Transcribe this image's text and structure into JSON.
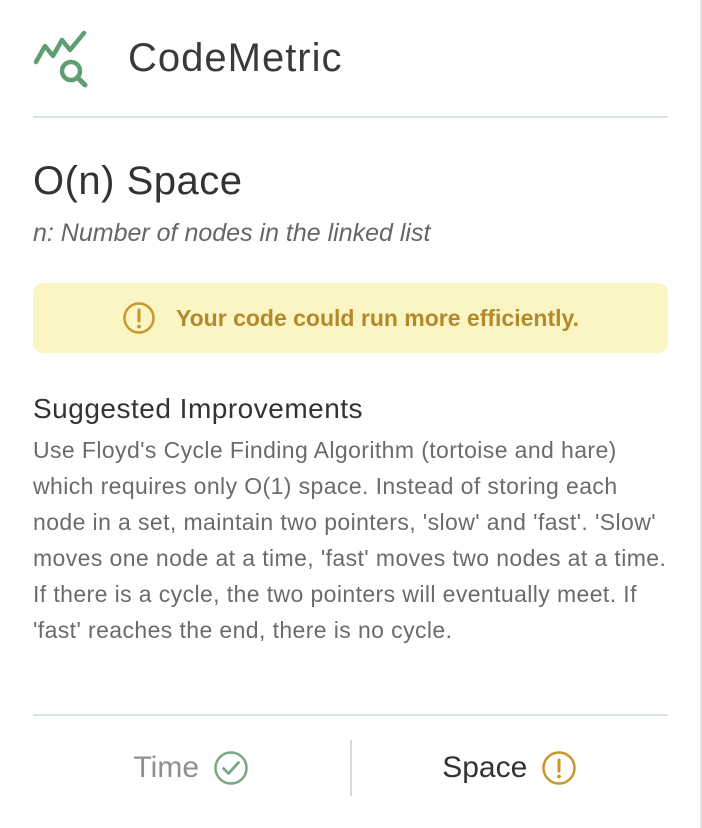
{
  "app": {
    "title": "CodeMetric",
    "logo_icon": "chart-search-icon",
    "accent_color": "#5e9e73"
  },
  "analysis": {
    "complexity_title": "O(n) Space",
    "variable_description": "n: Number of nodes in the linked list"
  },
  "alert": {
    "icon": "exclamation-circle-icon",
    "message": "Your code could run more efficiently.",
    "background_color": "#fbf5c4",
    "text_color": "#b38a2b"
  },
  "suggestions": {
    "heading": "Suggested Improvements",
    "body": "Use Floyd's Cycle Finding Algorithm (tortoise and hare) which requires only O(1) space. Instead of storing each node in a set, maintain two pointers, 'slow' and 'fast'. 'Slow' moves one node at a time, 'fast' moves two nodes at a time. If there is a cycle, the two pointers will eventually meet. If 'fast' reaches the end, there is no cycle."
  },
  "footer": {
    "tabs": [
      {
        "label": "Time",
        "status": "ok",
        "icon": "check-circle-icon",
        "color": "#7aa886"
      },
      {
        "label": "Space",
        "status": "warning",
        "icon": "exclamation-circle-icon",
        "color": "#c9962c",
        "selected": true
      }
    ]
  }
}
